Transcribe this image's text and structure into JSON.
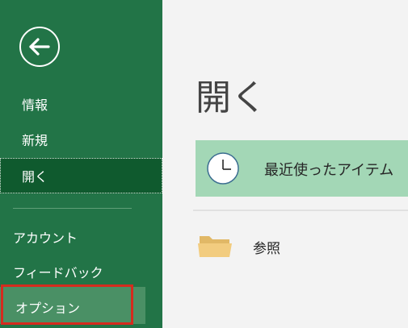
{
  "sidebar": {
    "back_icon": "arrow-left-circle-icon",
    "items_upper": [
      {
        "label": "情報"
      },
      {
        "label": "新規"
      },
      {
        "label": "開く",
        "selected": true
      }
    ],
    "items_lower": [
      {
        "label": "アカウント"
      },
      {
        "label": "フィードバック"
      },
      {
        "label": "オプション",
        "highlighted": true
      }
    ]
  },
  "main": {
    "title": "開く",
    "recent": {
      "label": "最近使ったアイテム",
      "icon": "clock-icon"
    },
    "browse": {
      "label": "参照",
      "icon": "folder-icon"
    }
  },
  "colors": {
    "sidebar_bg": "#227447",
    "selected_bg": "#0f5a2e",
    "recent_bg": "#a3d7b6",
    "annotation_red": "#d52b1e"
  }
}
